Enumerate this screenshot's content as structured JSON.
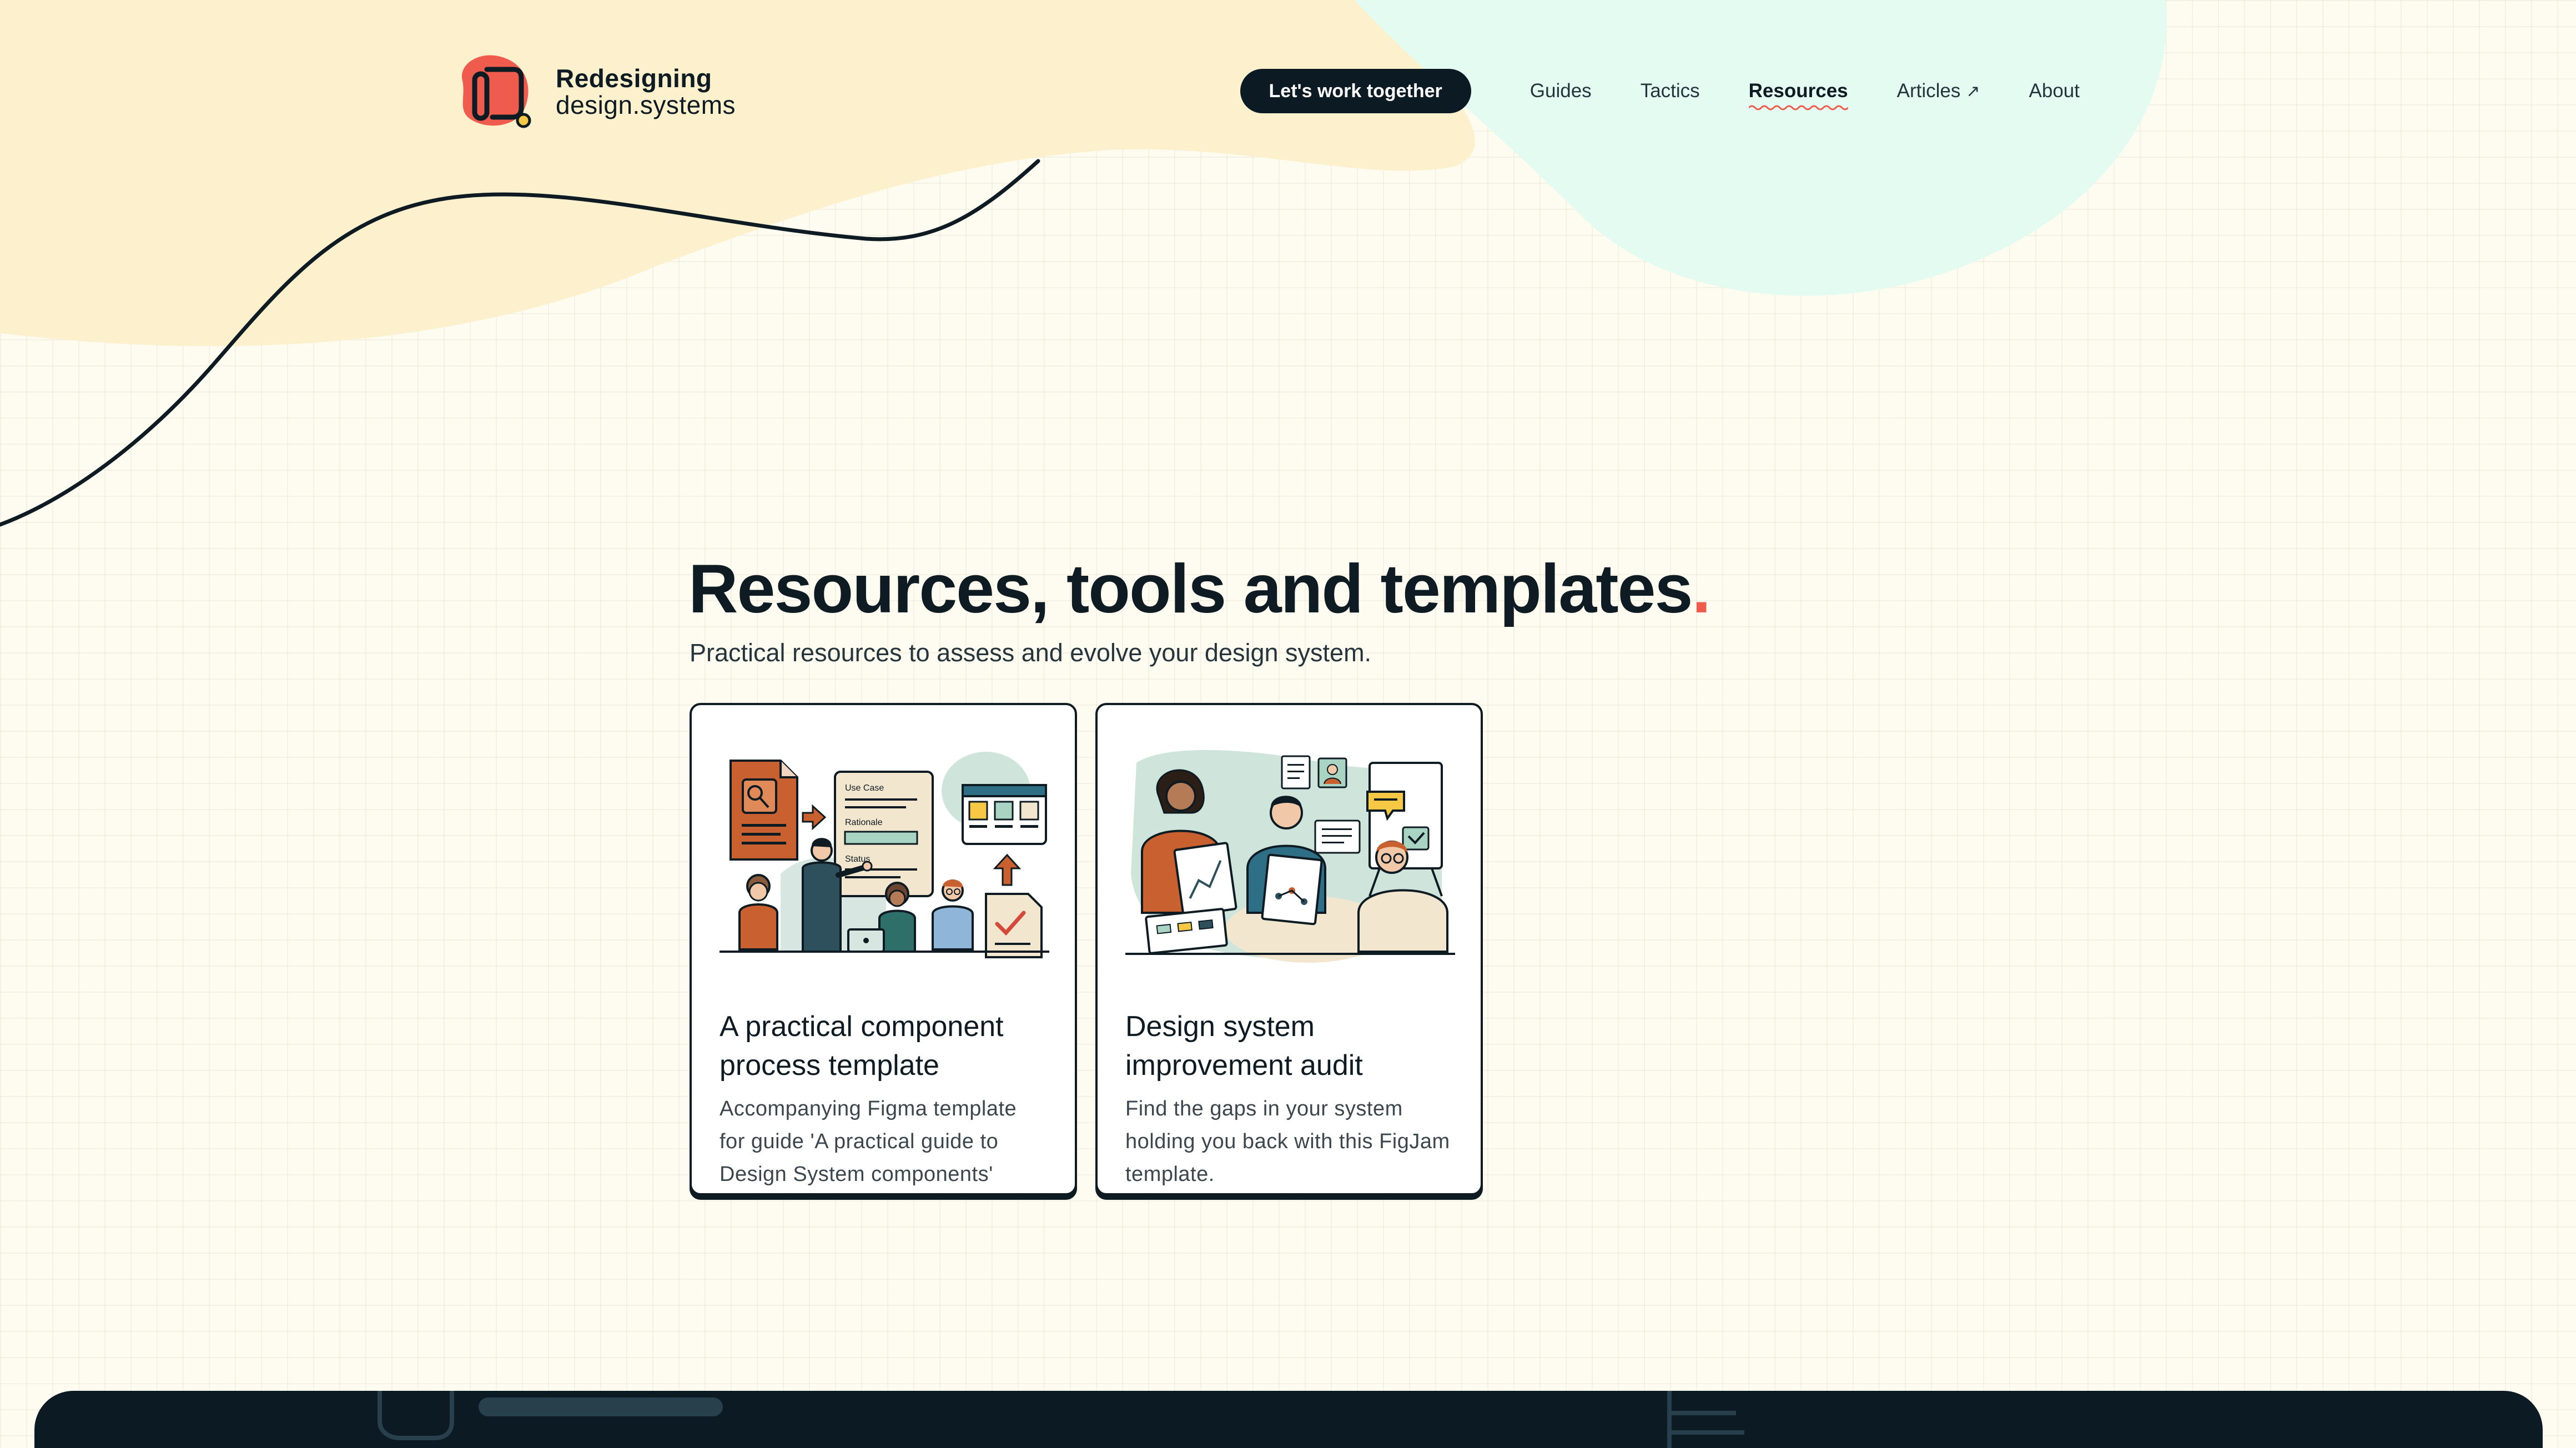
{
  "brand": {
    "line1": "Redesigning",
    "line2": "design.systems",
    "logo_icon": "rd-logo-icon",
    "accent_color": "#ef5b4c"
  },
  "nav": {
    "cta_label": "Let's work together",
    "links": [
      {
        "label": "Guides",
        "active": false
      },
      {
        "label": "Tactics",
        "active": false
      },
      {
        "label": "Resources",
        "active": true
      },
      {
        "label": "Articles",
        "active": false,
        "icon": "external-arrow-icon",
        "icon_glyph": "↗"
      },
      {
        "label": "About",
        "active": false
      }
    ]
  },
  "hero": {
    "title": "Resources, tools and templates",
    "title_dot": ".",
    "subtitle": "Practical resources to assess and evolve your design system."
  },
  "cards": [
    {
      "title": "A practical component process template",
      "description": "Accompanying Figma template for guide 'A practical guide to Design System components'",
      "illustration": "component-process-illustration",
      "illustration_labels": [
        "Use Case",
        "Rationale",
        "Status"
      ]
    },
    {
      "title": "Design system improvement audit",
      "description": "Find the gaps in your system holding you back with this FigJam template.",
      "illustration": "audit-team-illustration"
    }
  ],
  "colors": {
    "background": "#fefbf0",
    "blob_yellow": "#fdf0cc",
    "blob_mint": "#e3fbf1",
    "dark": "#0c1b23"
  }
}
